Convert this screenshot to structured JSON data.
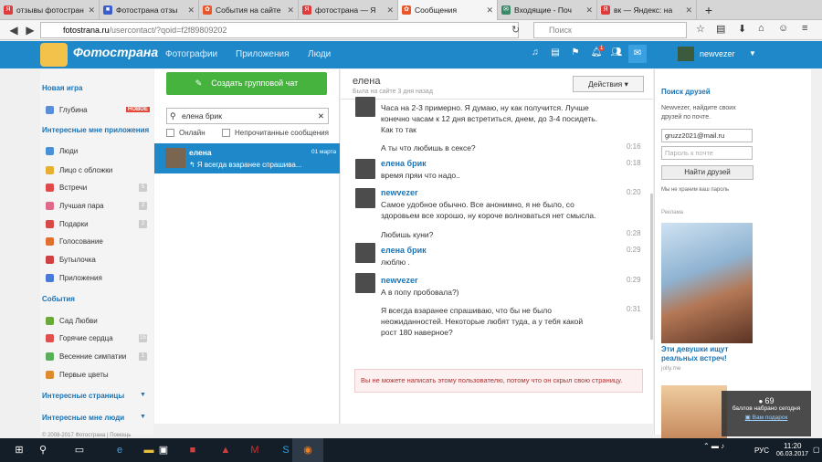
{
  "browser": {
    "tabs": [
      {
        "title": "отзывы фотостран",
        "icon_color": "#e03a3a",
        "icon_glyph": "Я"
      },
      {
        "title": "Фотострана отзы",
        "icon_color": "#3a5fcc",
        "icon_glyph": "■"
      },
      {
        "title": "События на сайте",
        "icon_color": "#e8562a",
        "icon_glyph": "✿"
      },
      {
        "title": "фотострана — Я",
        "icon_color": "#e03a3a",
        "icon_glyph": "Я"
      },
      {
        "title": "Сообщения",
        "icon_color": "#e8562a",
        "icon_glyph": "✿",
        "active": true
      },
      {
        "title": "Входящие - Поч",
        "icon_color": "#3a8a6a",
        "icon_glyph": "✉"
      },
      {
        "title": "вк — Яндекс: на",
        "icon_color": "#e03a3a",
        "icon_glyph": "Я"
      }
    ],
    "url_domain": "fotostrana.ru",
    "url_path": "/usercontact/?qoid=f2f89809202",
    "search_placeholder": "Поиск"
  },
  "site": {
    "logo": "Фотострана",
    "nav": [
      "Фотографии",
      "Приложения",
      "Люди"
    ],
    "username": "newvezer",
    "notif_count": "1",
    "brand_color": "#1f88c8"
  },
  "sidebar": {
    "sections": [
      {
        "title": "Новая игра",
        "items": [
          {
            "label": "Глубина",
            "badge": "НОВОЕ",
            "color": "#5a8ed8"
          }
        ]
      },
      {
        "title": "Интересные мне приложения",
        "items": [
          {
            "label": "Люди",
            "color": "#4a90d8"
          },
          {
            "label": "Лицо с обложки",
            "color": "#e8b030"
          },
          {
            "label": "Встречи",
            "color": "#e04a4a",
            "count": "5"
          },
          {
            "label": "Лучшая пара",
            "color": "#e06a8a",
            "count": "2"
          },
          {
            "label": "Подарки",
            "color": "#d84a4a",
            "count": "2"
          },
          {
            "label": "Голосование",
            "color": "#e07030"
          },
          {
            "label": "Бутылочка",
            "color": "#d04040"
          },
          {
            "label": "Приложения",
            "color": "#4a7ad8"
          }
        ]
      },
      {
        "title": "События",
        "items": [
          {
            "label": "Сад Любви",
            "color": "#6aaa3a"
          },
          {
            "label": "Горячие сердца",
            "color": "#e05050",
            "count": "15"
          },
          {
            "label": "Весенние симпатии",
            "color": "#5ab05a",
            "count": "1"
          },
          {
            "label": "Первые цветы",
            "color": "#e08a30"
          }
        ]
      },
      {
        "title": "Интересные страницы",
        "items": []
      },
      {
        "title": "Интересные мне люди",
        "items": []
      }
    ],
    "footer": "© 2008-2017 Фотострана | Помощь"
  },
  "chats": {
    "create_group": "Создать групповой чат",
    "search_value": "елена брик",
    "filter_online": "Онлайн",
    "filter_unread": "Непрочитанные сообщения",
    "active": {
      "name": "елена",
      "date": "01 марта",
      "preview": "↰ Я всегда взаранее спрашива..."
    }
  },
  "conversation": {
    "title": "елена",
    "subtitle": "Была на сайте 3 дня назад",
    "actions_label": "Действия",
    "messages": [
      {
        "text": "Часа на 2-3 примерно. Я думаю, ну как получится. Лучше конечно часам к 12 дня встретиться, днем, до 3-4 посидеть. Как то так",
        "time": ""
      },
      {
        "text": "А ты что любишь в сексе?",
        "time": "0:16"
      },
      {
        "author": "елена брик",
        "text": "время пряи что надо..",
        "time": "0:18"
      },
      {
        "author": "newvezer",
        "text": "Самое удобное обычно. Все анонимно, я не было, со здоровьем все хорошо, ну короче волноваться нет смысла.",
        "time": "0:20"
      },
      {
        "text": "Любишь куни?",
        "time": "0:28"
      },
      {
        "author": "елена брик",
        "text": "люблю .",
        "time": "0:29"
      },
      {
        "author": "newvezer",
        "text": "А в попу пробовала?)",
        "time": "0:29"
      },
      {
        "text": "Я всегда взаранее спрашиваю, что бы не было неожиданностей. Некоторые любят туда, а у тебя какой рост 180 наверное?",
        "time": "0:31"
      }
    ],
    "blocked_notice": "Вы не можете написать этому пользователю, потому что он скрыл свою страницу."
  },
  "right": {
    "title": "Поиск друзей",
    "desc": "Newvezer, найдите своих друзей по почте.",
    "email_value": "gruzz2021@mail.ru",
    "password_placeholder": "Пароль к почте",
    "find_button": "Найти друзей",
    "note": "Мы не храним ваш пароль",
    "ads_label": "Реклама",
    "ad_title": "Эти девушки ищут реальных встреч!",
    "ad_domain": "jolly.me",
    "score_value": "69",
    "score_label": "баллов набрано сегодня",
    "score_link": "Вам подарок"
  },
  "taskbar": {
    "lang": "РУС",
    "time": "11:20",
    "date": "06.03.2017"
  }
}
